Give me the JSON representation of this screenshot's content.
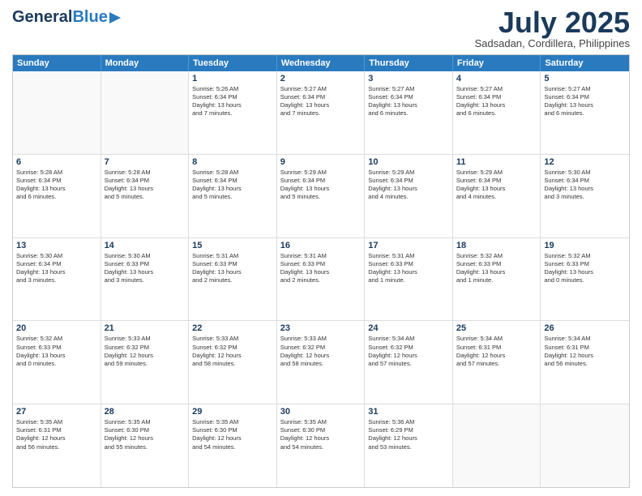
{
  "header": {
    "logo_general": "General",
    "logo_blue": "Blue",
    "month_title": "July 2025",
    "location": "Sadsadan, Cordillera, Philippines"
  },
  "weekdays": [
    "Sunday",
    "Monday",
    "Tuesday",
    "Wednesday",
    "Thursday",
    "Friday",
    "Saturday"
  ],
  "weeks": [
    [
      {
        "day": "",
        "info": ""
      },
      {
        "day": "",
        "info": ""
      },
      {
        "day": "1",
        "info": "Sunrise: 5:26 AM\nSunset: 6:34 PM\nDaylight: 13 hours\nand 7 minutes."
      },
      {
        "day": "2",
        "info": "Sunrise: 5:27 AM\nSunset: 6:34 PM\nDaylight: 13 hours\nand 7 minutes."
      },
      {
        "day": "3",
        "info": "Sunrise: 5:27 AM\nSunset: 6:34 PM\nDaylight: 13 hours\nand 6 minutes."
      },
      {
        "day": "4",
        "info": "Sunrise: 5:27 AM\nSunset: 6:34 PM\nDaylight: 13 hours\nand 6 minutes."
      },
      {
        "day": "5",
        "info": "Sunrise: 5:27 AM\nSunset: 6:34 PM\nDaylight: 13 hours\nand 6 minutes."
      }
    ],
    [
      {
        "day": "6",
        "info": "Sunrise: 5:28 AM\nSunset: 6:34 PM\nDaylight: 13 hours\nand 6 minutes."
      },
      {
        "day": "7",
        "info": "Sunrise: 5:28 AM\nSunset: 6:34 PM\nDaylight: 13 hours\nand 5 minutes."
      },
      {
        "day": "8",
        "info": "Sunrise: 5:28 AM\nSunset: 6:34 PM\nDaylight: 13 hours\nand 5 minutes."
      },
      {
        "day": "9",
        "info": "Sunrise: 5:29 AM\nSunset: 6:34 PM\nDaylight: 13 hours\nand 5 minutes."
      },
      {
        "day": "10",
        "info": "Sunrise: 5:29 AM\nSunset: 6:34 PM\nDaylight: 13 hours\nand 4 minutes."
      },
      {
        "day": "11",
        "info": "Sunrise: 5:29 AM\nSunset: 6:34 PM\nDaylight: 13 hours\nand 4 minutes."
      },
      {
        "day": "12",
        "info": "Sunrise: 5:30 AM\nSunset: 6:34 PM\nDaylight: 13 hours\nand 3 minutes."
      }
    ],
    [
      {
        "day": "13",
        "info": "Sunrise: 5:30 AM\nSunset: 6:34 PM\nDaylight: 13 hours\nand 3 minutes."
      },
      {
        "day": "14",
        "info": "Sunrise: 5:30 AM\nSunset: 6:33 PM\nDaylight: 13 hours\nand 3 minutes."
      },
      {
        "day": "15",
        "info": "Sunrise: 5:31 AM\nSunset: 6:33 PM\nDaylight: 13 hours\nand 2 minutes."
      },
      {
        "day": "16",
        "info": "Sunrise: 5:31 AM\nSunset: 6:33 PM\nDaylight: 13 hours\nand 2 minutes."
      },
      {
        "day": "17",
        "info": "Sunrise: 5:31 AM\nSunset: 6:33 PM\nDaylight: 13 hours\nand 1 minute."
      },
      {
        "day": "18",
        "info": "Sunrise: 5:32 AM\nSunset: 6:33 PM\nDaylight: 13 hours\nand 1 minute."
      },
      {
        "day": "19",
        "info": "Sunrise: 5:32 AM\nSunset: 6:33 PM\nDaylight: 13 hours\nand 0 minutes."
      }
    ],
    [
      {
        "day": "20",
        "info": "Sunrise: 5:32 AM\nSunset: 6:33 PM\nDaylight: 13 hours\nand 0 minutes."
      },
      {
        "day": "21",
        "info": "Sunrise: 5:33 AM\nSunset: 6:32 PM\nDaylight: 12 hours\nand 59 minutes."
      },
      {
        "day": "22",
        "info": "Sunrise: 5:33 AM\nSunset: 6:32 PM\nDaylight: 12 hours\nand 58 minutes."
      },
      {
        "day": "23",
        "info": "Sunrise: 5:33 AM\nSunset: 6:32 PM\nDaylight: 12 hours\nand 58 minutes."
      },
      {
        "day": "24",
        "info": "Sunrise: 5:34 AM\nSunset: 6:32 PM\nDaylight: 12 hours\nand 57 minutes."
      },
      {
        "day": "25",
        "info": "Sunrise: 5:34 AM\nSunset: 6:31 PM\nDaylight: 12 hours\nand 57 minutes."
      },
      {
        "day": "26",
        "info": "Sunrise: 5:34 AM\nSunset: 6:31 PM\nDaylight: 12 hours\nand 56 minutes."
      }
    ],
    [
      {
        "day": "27",
        "info": "Sunrise: 5:35 AM\nSunset: 6:31 PM\nDaylight: 12 hours\nand 56 minutes."
      },
      {
        "day": "28",
        "info": "Sunrise: 5:35 AM\nSunset: 6:30 PM\nDaylight: 12 hours\nand 55 minutes."
      },
      {
        "day": "29",
        "info": "Sunrise: 5:35 AM\nSunset: 6:30 PM\nDaylight: 12 hours\nand 54 minutes."
      },
      {
        "day": "30",
        "info": "Sunrise: 5:35 AM\nSunset: 6:30 PM\nDaylight: 12 hours\nand 54 minutes."
      },
      {
        "day": "31",
        "info": "Sunrise: 5:36 AM\nSunset: 6:29 PM\nDaylight: 12 hours\nand 53 minutes."
      },
      {
        "day": "",
        "info": ""
      },
      {
        "day": "",
        "info": ""
      }
    ]
  ]
}
